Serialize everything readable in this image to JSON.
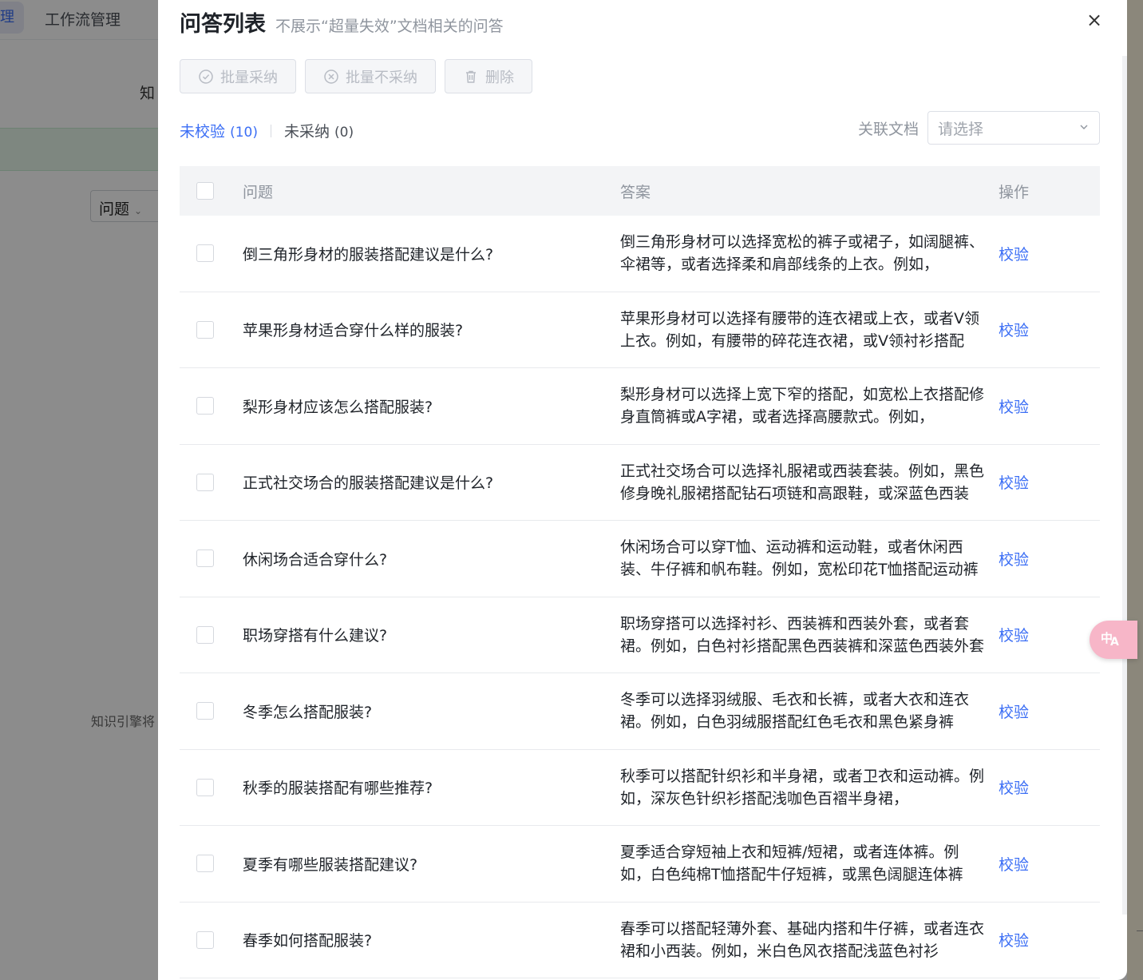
{
  "background": {
    "active_tab_fragment": "理",
    "tab_workflow": "工作流管理",
    "label_fragment": "知",
    "select_value": "问题",
    "note_fragment": "知识引擎将"
  },
  "drawer": {
    "title": "问答列表",
    "subtitle": "不展示“超量失效”文档相关的问答",
    "close_icon": "×"
  },
  "toolbar": {
    "batch_accept": "批量采纳",
    "batch_reject": "批量不采纳",
    "delete": "删除"
  },
  "tabs": {
    "unverified_label": "未校验",
    "unverified_count": "(10)",
    "unaccepted_label": "未采纳",
    "unaccepted_count": "(0)"
  },
  "filter": {
    "label": "关联文档",
    "placeholder": "请选择"
  },
  "table": {
    "headers": {
      "question": "问题",
      "answer": "答案",
      "action": "操作"
    },
    "rows": [
      {
        "question": "倒三角形身材的服装搭配建议是什么?",
        "answer": "倒三角形身材可以选择宽松的裤子或裙子，如阔腿裤、伞裙等，或者选择柔和肩部线条的上衣。例如，",
        "action": "校验"
      },
      {
        "question": "苹果形身材适合穿什么样的服装?",
        "answer": "苹果形身材可以选择有腰带的连衣裙或上衣，或者V领上衣。例如，有腰带的碎花连衣裙，或V领衬衫搭配",
        "action": "校验"
      },
      {
        "question": "梨形身材应该怎么搭配服装?",
        "answer": "梨形身材可以选择上宽下窄的搭配，如宽松上衣搭配修身直筒裤或A字裙，或者选择高腰款式。例如，",
        "action": "校验"
      },
      {
        "question": "正式社交场合的服装搭配建议是什么?",
        "answer": "正式社交场合可以选择礼服裙或西装套装。例如，黑色修身晚礼服裙搭配钻石项链和高跟鞋，或深蓝色西装",
        "action": "校验"
      },
      {
        "question": "休闲场合适合穿什么?",
        "answer": "休闲场合可以穿T恤、运动裤和运动鞋，或者休闲西装、牛仔裤和帆布鞋。例如，宽松印花T恤搭配运动裤",
        "action": "校验"
      },
      {
        "question": "职场穿搭有什么建议?",
        "answer": "职场穿搭可以选择衬衫、西装裤和西装外套，或者套裙。例如，白色衬衫搭配黑色西装裤和深蓝色西装外套",
        "action": "校验"
      },
      {
        "question": "冬季怎么搭配服装?",
        "answer": "冬季可以选择羽绒服、毛衣和长裤，或者大衣和连衣裙。例如，白色羽绒服搭配红色毛衣和黑色紧身裤",
        "action": "校验"
      },
      {
        "question": "秋季的服装搭配有哪些推荐?",
        "answer": "秋季可以搭配针织衫和半身裙，或者卫衣和运动裤。例如，深灰色针织衫搭配浅咖色百褶半身裙，",
        "action": "校验"
      },
      {
        "question": "夏季有哪些服装搭配建议?",
        "answer": "夏季适合穿短袖上衣和短裤/短裙，或者连体裤。例如，白色纯棉T恤搭配牛仔短裤，或黑色阔腿连体裤",
        "action": "校验"
      },
      {
        "question": "春季如何搭配服装?",
        "answer": "春季可以搭配轻薄外套、基础内搭和牛仔裤，或者连衣裙和小西装。例如，米白色风衣搭配浅蓝色衬衫",
        "action": "校验"
      }
    ]
  },
  "float_button": {
    "icon": "translate-icon"
  }
}
